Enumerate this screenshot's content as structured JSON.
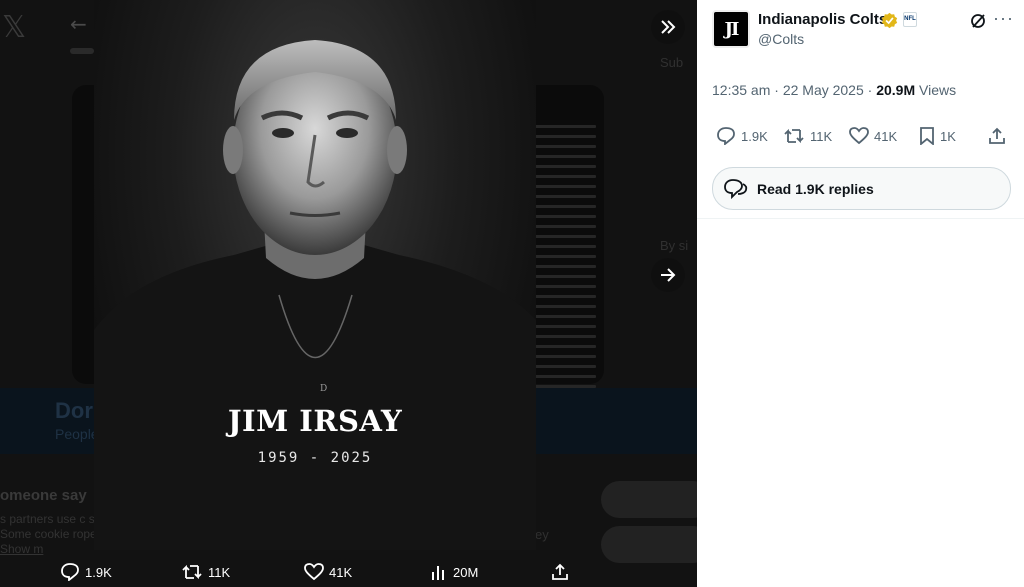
{
  "background": {
    "banner_title": "Dor",
    "banner_subtitle": "People",
    "cookie_title": "omeone say",
    "cookie_text": "s partners use c ss. Some cookie roperly.",
    "cookie_link": "Show m",
    "right_text_a": "Sub",
    "right_text_b": "By si",
    "right_text_c": "ey"
  },
  "media": {
    "name": "JIM IRSAY",
    "years": "1959 - 2025",
    "pendant_letter": "D"
  },
  "controls": {
    "collapse_icon": "double-chevron-right-icon",
    "next_icon": "arrow-right-icon"
  },
  "action_bar": {
    "replies": "1.9K",
    "reposts": "11K",
    "likes": "41K",
    "views": "20M"
  },
  "tweet": {
    "account_name": "Indianapolis Colts",
    "handle": "@Colts",
    "avatar_text": "JI",
    "affiliate_badge": "NFL",
    "timestamp": "12:35 am · 22 May 2025 · ",
    "views_count": "20.9M",
    "views_label": " Views",
    "replies": "1.9K",
    "reposts": "11K",
    "likes": "41K",
    "bookmarks": "1K",
    "read_replies_label": "Read 1.9K replies",
    "colors": {
      "verified": "#e2b719",
      "accent": "#0f1419",
      "muted": "#536471"
    }
  }
}
